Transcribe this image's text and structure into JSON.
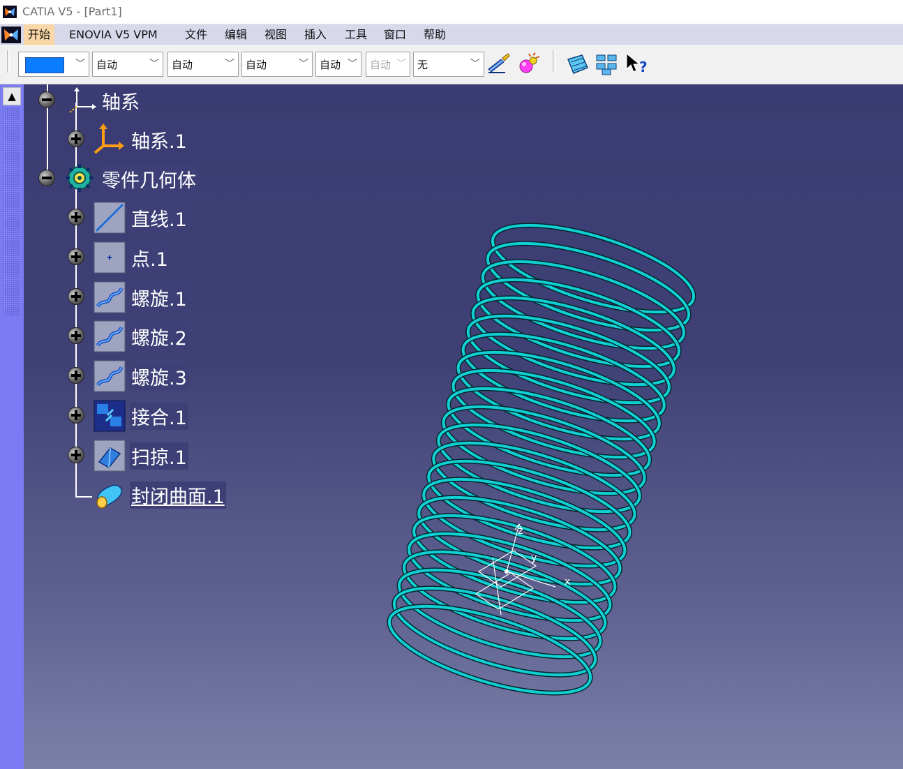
{
  "window": {
    "title": "CATIA V5 - [Part1]"
  },
  "menubar": {
    "items": [
      "开始",
      "ENOVIA V5 VPM",
      "文件",
      "编辑",
      "视图",
      "插入",
      "工具",
      "窗口",
      "帮助"
    ]
  },
  "toolbar": {
    "color_value": "",
    "combos": [
      "自动",
      "自动",
      "自动",
      "自动",
      "自动",
      "无"
    ],
    "buttons": [
      "painter-icon",
      "apply-material-icon",
      "show-hide-icon",
      "layer-icon",
      "whats-this-icon"
    ]
  },
  "sidebar": {
    "scroll_up": "▲"
  },
  "tree": {
    "axes_group": "轴系",
    "axis_system": "轴系.1",
    "body": "零件几何体",
    "items": [
      "直线.1",
      "点.1",
      "螺旋.1",
      "螺旋.2",
      "螺旋.3",
      "接合.1",
      "扫掠.1",
      "封闭曲面.1"
    ]
  },
  "compass": {
    "x_label": "x",
    "y_label": "y",
    "z_label": "z"
  },
  "colors": {
    "spring": "#11d0d4",
    "background_top": "#3a3b72",
    "background_bottom": "#7c80a8",
    "menu_active": "#fad7a6"
  }
}
